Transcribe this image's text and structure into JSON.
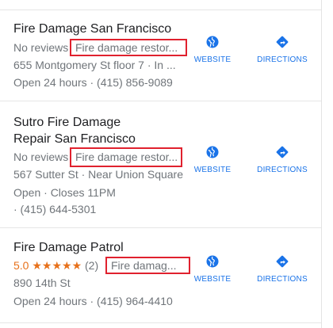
{
  "listings": [
    {
      "name_lines": [
        "Fire Damage San Francisco"
      ],
      "reviews": "No reviews",
      "category": "Fire damage restor...",
      "address": "655 Montgomery St floor 7 · In ...",
      "hours": "Open 24 hours · (415) 856-9089",
      "website_label": "WEBSITE",
      "directions_label": "DIRECTIONS"
    },
    {
      "name_lines": [
        "Sutro Fire Damage",
        "Repair San Francisco"
      ],
      "reviews": "No reviews",
      "category": "Fire damage restor...",
      "address": "567 Sutter St · Near Union Square",
      "hours": "Open · Closes 11PM",
      "phone": "· (415) 644-5301",
      "website_label": "WEBSITE",
      "directions_label": "DIRECTIONS"
    },
    {
      "name_lines": [
        "Fire Damage Patrol"
      ],
      "rating": "5.0",
      "stars": "★★★★★",
      "review_count": "(2)",
      "category": "Fire damag...",
      "address": "890 14th St",
      "hours": "Open 24 hours · (415) 964-4410",
      "website_label": "WEBSITE",
      "directions_label": "DIRECTIONS"
    }
  ],
  "icons": {
    "website": "globe-icon",
    "directions": "directions-arrow-icon"
  },
  "colors": {
    "accent": "#1a73e8",
    "highlight_box": "#e0212e",
    "rating": "#e7711b",
    "secondary_text": "#70757a"
  }
}
